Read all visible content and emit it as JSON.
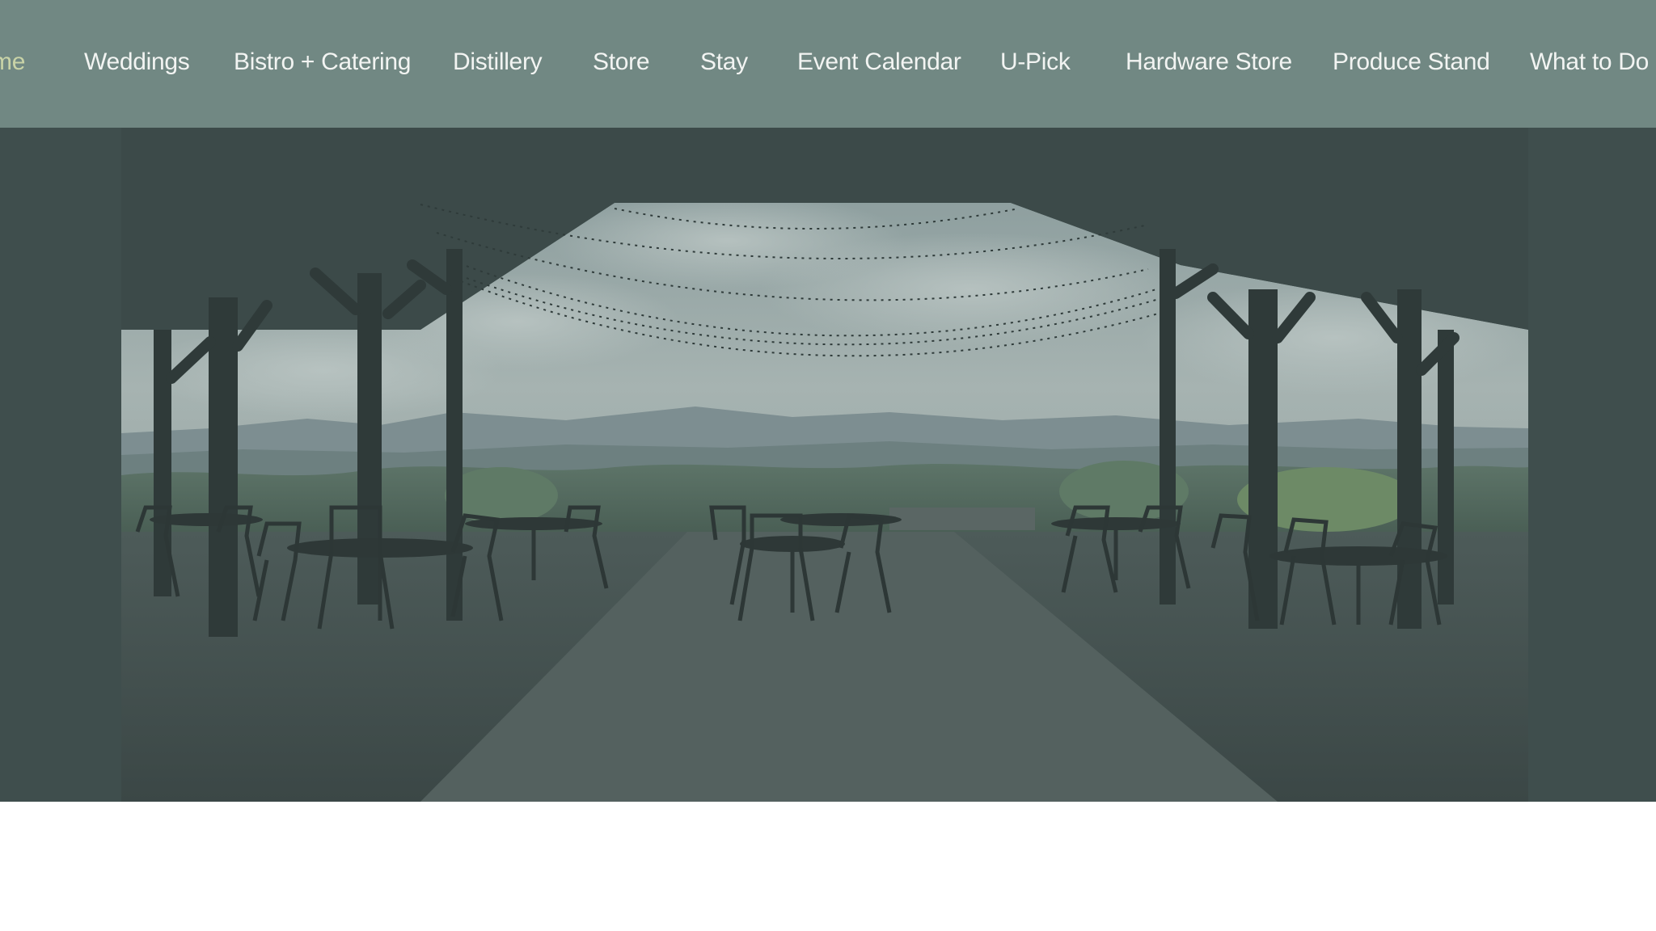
{
  "nav": {
    "items": [
      {
        "label": "me",
        "active": true
      },
      {
        "label": "Weddings"
      },
      {
        "label": "Bistro + Catering"
      },
      {
        "label": "Distillery"
      },
      {
        "label": "Store"
      },
      {
        "label": "Stay"
      },
      {
        "label": "Event Calendar"
      },
      {
        "label": "U-Pick"
      },
      {
        "label": "Hardware Store"
      },
      {
        "label": "Produce Stand"
      },
      {
        "label": "What to Do i"
      }
    ]
  },
  "colors": {
    "nav_bg": "#718883",
    "nav_text": "#f2f4f2",
    "nav_active": "#c9d3a7",
    "hero_bg": "#3f4e4d"
  },
  "hero": {
    "image": "pavilion-with-tables-overlooking-mountains"
  }
}
